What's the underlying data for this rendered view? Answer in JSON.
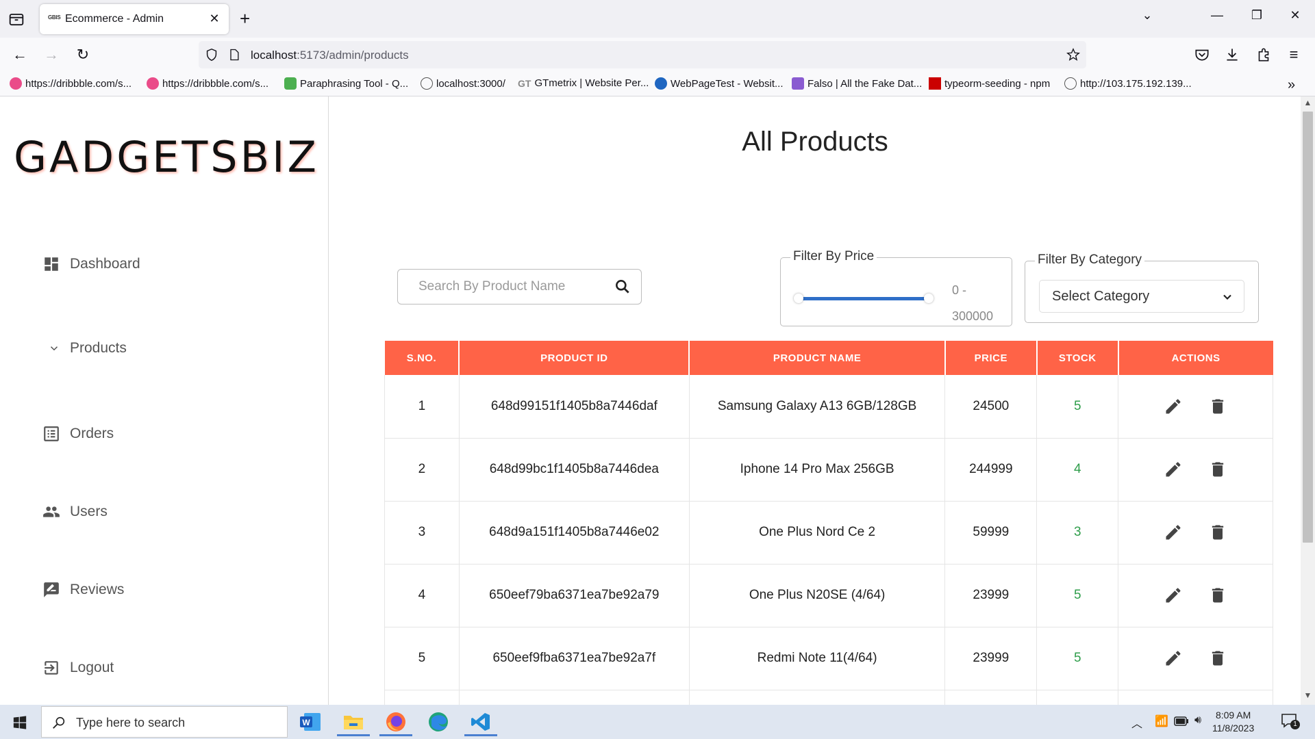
{
  "browser": {
    "tab_title": "Ecommerce - Admin",
    "tab_favicon_text": "GBIS",
    "url_host": "localhost",
    "url_path": ":5173/admin/products",
    "bookmarks": [
      "https://dribbble.com/s...",
      "https://dribbble.com/s...",
      "Paraphrasing Tool - Q...",
      "localhost:3000/",
      "GTmetrix | Website Per...",
      "WebPageTest - Websit...",
      "Falso | All the Fake Dat...",
      "typeorm-seeding - npm",
      "http://103.175.192.139..."
    ]
  },
  "sidebar": {
    "logo": "GADGETSBIZ",
    "items": [
      {
        "label": "Dashboard",
        "icon": "dashboard-icon"
      },
      {
        "label": "Products",
        "icon": "chevron-down-icon"
      },
      {
        "label": "Orders",
        "icon": "list-alt-icon"
      },
      {
        "label": "Users",
        "icon": "people-icon"
      },
      {
        "label": "Reviews",
        "icon": "rate-review-icon"
      },
      {
        "label": "Logout",
        "icon": "logout-icon"
      }
    ]
  },
  "main": {
    "title": "All Products",
    "search_placeholder": "Search By Product Name",
    "price_filter": {
      "legend": "Filter By Price",
      "range_text_1": "0 -",
      "range_text_2": "300000"
    },
    "category_filter": {
      "legend": "Filter By Category",
      "selected": "Select Category"
    },
    "table": {
      "headers": [
        "S.NO.",
        "PRODUCT ID",
        "PRODUCT NAME",
        "PRICE",
        "STOCK",
        "ACTIONS"
      ],
      "rows": [
        {
          "sno": "1",
          "id": "648d99151f1405b8a7446daf",
          "name": "Samsung Galaxy A13 6GB/128GB",
          "price": "24500",
          "stock": "5"
        },
        {
          "sno": "2",
          "id": "648d99bc1f1405b8a7446dea",
          "name": "Iphone 14 Pro Max 256GB",
          "price": "244999",
          "stock": "4"
        },
        {
          "sno": "3",
          "id": "648d9a151f1405b8a7446e02",
          "name": "One Plus Nord Ce 2",
          "price": "59999",
          "stock": "3"
        },
        {
          "sno": "4",
          "id": "650eef79ba6371ea7be92a79",
          "name": "One Plus N20SE (4/64)",
          "price": "23999",
          "stock": "5"
        },
        {
          "sno": "5",
          "id": "650eef9fba6371ea7be92a7f",
          "name": "Redmi Note 11(4/64)",
          "price": "23999",
          "stock": "5"
        }
      ]
    }
  },
  "taskbar": {
    "search_placeholder": "Type here to search",
    "time": "8:09 AM",
    "date": "11/8/2023",
    "notification_count": "1"
  },
  "colors": {
    "accent": "#ff6347",
    "stock": "#2e9d4a",
    "slider": "#2f6fc8"
  }
}
